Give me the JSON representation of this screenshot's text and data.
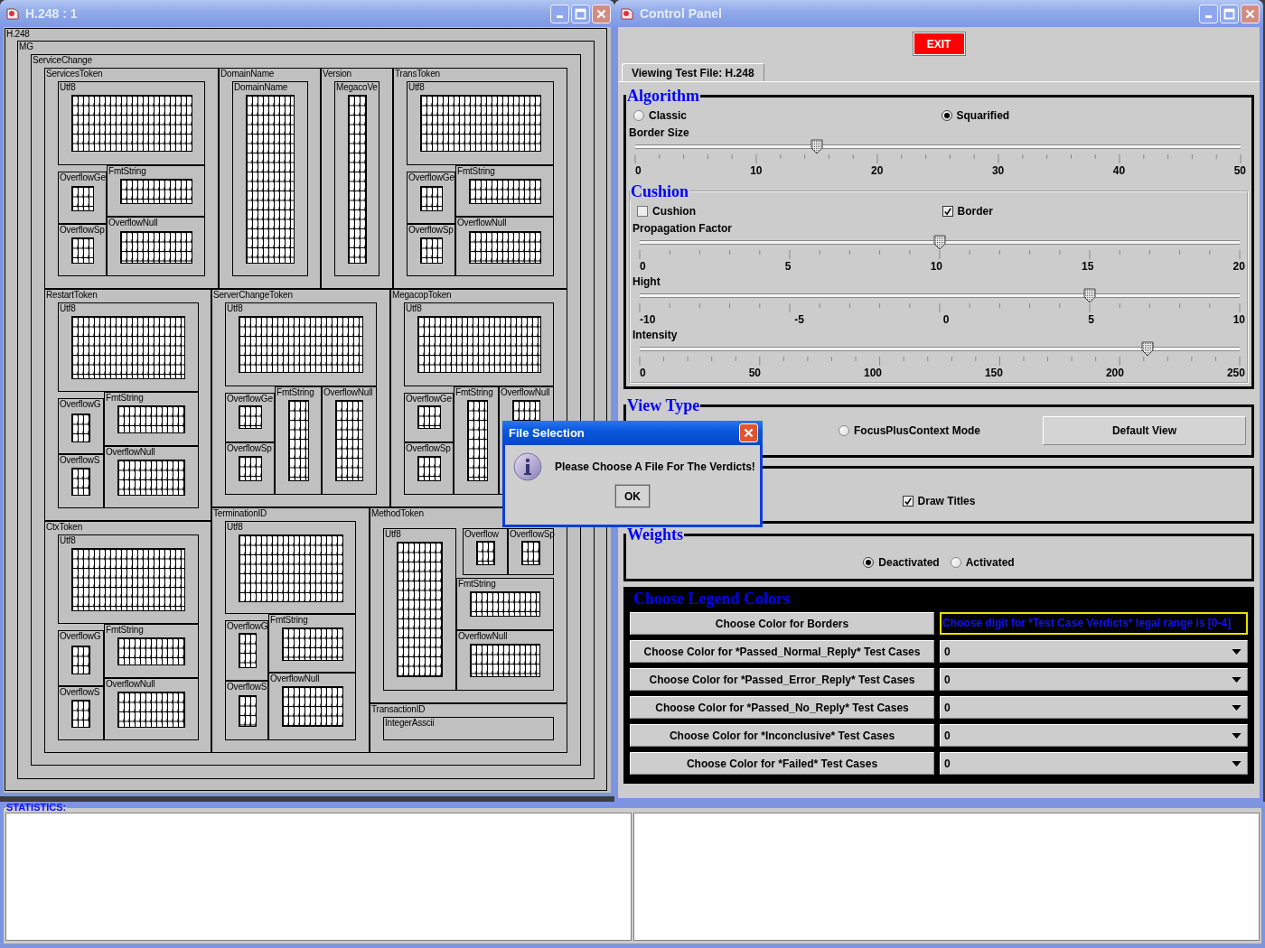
{
  "treemap_window": {
    "title": "H.248 : 1",
    "nodes": [
      {
        "label": "H.248",
        "children": [
          {
            "label": "MG",
            "children": [
              {
                "label": "ServiceChange",
                "children": [
                  {
                    "label": "ServicesToken",
                    "children": [
                      {
                        "label": "Utf8"
                      },
                      {
                        "label": "OverflowGe"
                      },
                      {
                        "label": "FmtString"
                      },
                      {
                        "label": "OverflowSp"
                      },
                      {
                        "label": "OverflowNull"
                      }
                    ]
                  },
                  {
                    "label": "DomainName",
                    "children": [
                      {
                        "label": "DomainName"
                      }
                    ]
                  },
                  {
                    "label": "Version",
                    "children": [
                      {
                        "label": "MegacoVe"
                      }
                    ]
                  },
                  {
                    "label": "TransToken",
                    "children": [
                      {
                        "label": "Utf8"
                      },
                      {
                        "label": "OverflowGe"
                      },
                      {
                        "label": "FmtString"
                      },
                      {
                        "label": "OverflowSp"
                      },
                      {
                        "label": "OverflowNull"
                      }
                    ]
                  },
                  {
                    "label": "RestartToken",
                    "children": [
                      {
                        "label": "Utf8"
                      },
                      {
                        "label": "OverflowG"
                      },
                      {
                        "label": "FmtString"
                      },
                      {
                        "label": "OverflowS"
                      },
                      {
                        "label": "OverflowNull"
                      }
                    ]
                  },
                  {
                    "label": "ServerChangeToken",
                    "children": [
                      {
                        "label": "Utf8"
                      },
                      {
                        "label": "OverflowGe"
                      },
                      {
                        "label": "OverflowSp"
                      },
                      {
                        "label": "FmtString"
                      },
                      {
                        "label": "OverflowNull"
                      }
                    ]
                  },
                  {
                    "label": "MegacopToken",
                    "children": [
                      {
                        "label": "Utf8"
                      },
                      {
                        "label": "OverflowGe"
                      },
                      {
                        "label": "OverflowSp"
                      },
                      {
                        "label": "FmtString"
                      },
                      {
                        "label": "OverflowNull"
                      }
                    ]
                  },
                  {
                    "label": "CtxToken",
                    "children": [
                      {
                        "label": "Utf8"
                      },
                      {
                        "label": "OverflowG"
                      },
                      {
                        "label": "FmtString"
                      },
                      {
                        "label": "OverflowS"
                      },
                      {
                        "label": "OverflowNull"
                      }
                    ]
                  },
                  {
                    "label": "TerminationID",
                    "children": [
                      {
                        "label": "Utf8"
                      },
                      {
                        "label": "OverflowG"
                      },
                      {
                        "label": "FmtString"
                      },
                      {
                        "label": "OverflowS"
                      },
                      {
                        "label": "OverflowNull"
                      }
                    ]
                  },
                  {
                    "label": "MethodToken",
                    "children": [
                      {
                        "label": "Utf8"
                      },
                      {
                        "label": "Overflow"
                      },
                      {
                        "label": "OverflowSp"
                      },
                      {
                        "label": "FmtString"
                      },
                      {
                        "label": "OverflowNull"
                      }
                    ]
                  },
                  {
                    "label": "TransactionID",
                    "children": [
                      {
                        "label": "IntegerAsscii"
                      }
                    ]
                  }
                ]
              }
            ]
          }
        ]
      }
    ]
  },
  "control_panel": {
    "title": "Control Panel",
    "exit_button": "EXIT",
    "tab": {
      "label": "Viewing Test File: H.248",
      "selected": true
    },
    "algorithm": {
      "title": "Algorithm",
      "options": [
        {
          "label": "Classic",
          "selected": false
        },
        {
          "label": "Squarified",
          "selected": true
        }
      ],
      "sliders": [
        {
          "label": "Border Size",
          "level": 0.3,
          "ticks": [
            "0",
            "10",
            "20",
            "30",
            "40",
            "50"
          ]
        }
      ]
    },
    "cushion": {
      "title": "Cushion",
      "checkboxes": [
        {
          "label": "Cushion",
          "checked": false
        },
        {
          "label": "Border",
          "checked": true
        }
      ],
      "sliders": [
        {
          "label": "Propagation Factor",
          "level": 0.5,
          "ticks": [
            "0",
            "5",
            "10",
            "15",
            "20"
          ]
        },
        {
          "label": "Hight",
          "level": 0.75,
          "ticks": [
            "-10",
            "-5",
            "0",
            "5",
            "10"
          ]
        },
        {
          "label": "Intensity",
          "level": 0.846,
          "ticks": [
            "0",
            "50",
            "100",
            "150",
            "200",
            "250"
          ]
        }
      ]
    },
    "view_type": {
      "title": "View Type",
      "options": [
        {
          "label": "FocusPlusContext Mode",
          "selected": false
        }
      ],
      "button": "Default View"
    },
    "titles": {
      "checkboxes": [
        {
          "label": "Draw Titles",
          "checked": true
        }
      ]
    },
    "weights": {
      "title": "Weights",
      "options": [
        {
          "label": "Deactivated",
          "selected": true
        },
        {
          "label": "Activated",
          "selected": false
        }
      ]
    },
    "legend": {
      "title": "Choose Legend Colors",
      "rows": [
        {
          "kind": "note",
          "button": "Choose Color for Borders",
          "value": "Choose digit for *Test Case Verdicts* legal range is [0-4]"
        },
        {
          "kind": "dropdown",
          "button": "Choose Color for *Passed_Normal_Reply* Test Cases",
          "value": "0"
        },
        {
          "kind": "dropdown",
          "button": "Choose Color for *Passed_Error_Reply* Test Cases",
          "value": "0"
        },
        {
          "kind": "dropdown",
          "button": "Choose Color for *Passed_No_Reply* Test Cases",
          "value": "0"
        },
        {
          "kind": "dropdown",
          "button": "Choose Color for *Inconclusive* Test Cases",
          "value": "0"
        },
        {
          "kind": "dropdown",
          "button": "Choose Color for *Failed* Test Cases",
          "value": "0"
        }
      ]
    }
  },
  "statistics": {
    "title": "STATISTICS:"
  },
  "dialog": {
    "title": "File Selection",
    "message": "Please Choose A File For The Verdicts!",
    "button": "OK"
  }
}
